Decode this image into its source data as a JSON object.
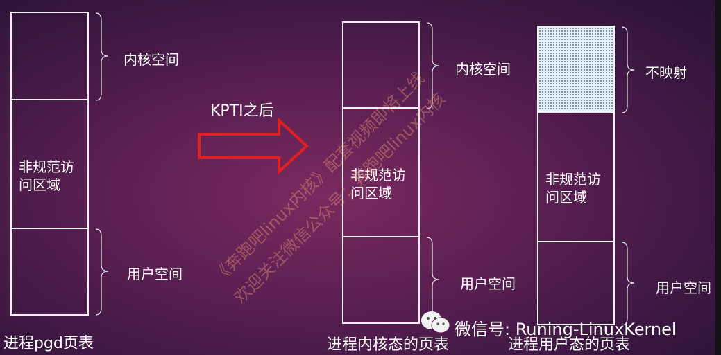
{
  "arrow_label": "KPTI之后",
  "columns": [
    {
      "caption": "进程pgd页表",
      "top_label": "内核空间",
      "middle_label": "非规范访\n问区域",
      "bottom_label": "用户空间"
    },
    {
      "caption": "进程内核态的页表",
      "top_label": "内核空间",
      "middle_label": "非规范访\n问区域",
      "bottom_label": "用户空间"
    },
    {
      "caption": "进程用户态的页表",
      "top_label": "不映射",
      "middle_label": "非规范访\n问区域",
      "bottom_label": "用户空间"
    }
  ],
  "watermark": {
    "line1": "《奔跑吧linux内核》配套视频即将上线",
    "line2": "欢迎关注微信公众号：奔跑吧linux内核"
  },
  "footer": {
    "wechat_text": "微信号: Runing-LinuxKernel"
  },
  "colors": {
    "arrow": "#e02020",
    "not_mapped_fill": "#e9eef2"
  },
  "icons": {
    "wechat": "wechat-icon",
    "arrow": "right-arrow-icon"
  }
}
